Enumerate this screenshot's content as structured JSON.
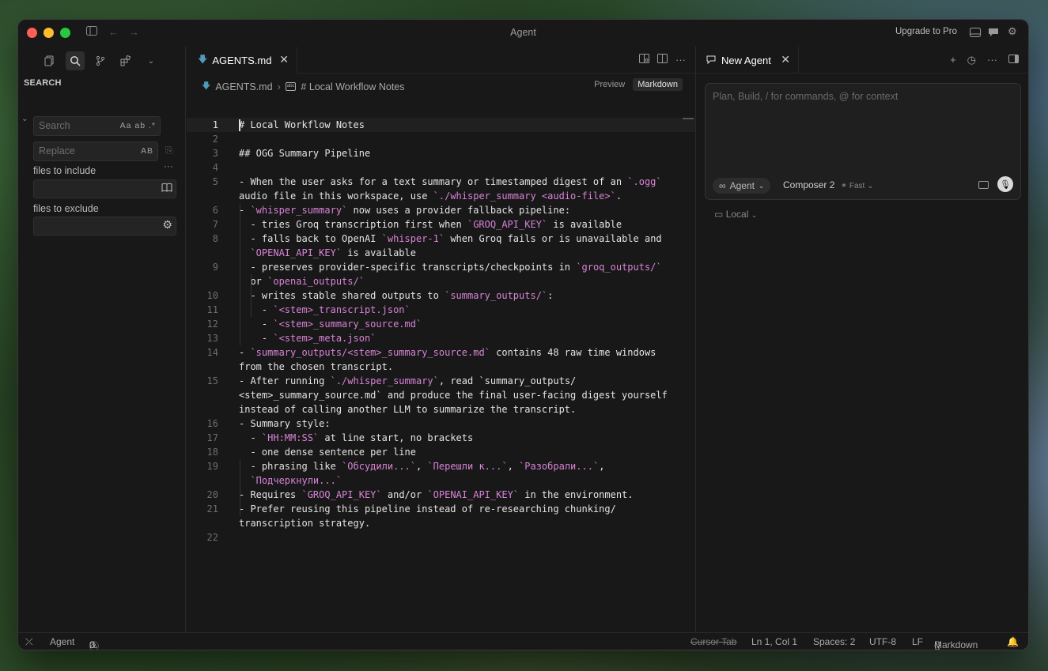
{
  "window": {
    "title": "Agent",
    "upgrade_label": "Upgrade to Pro"
  },
  "sidebar": {
    "title": "SEARCH",
    "search": {
      "placeholder": "Search",
      "options": "Aa ab .*"
    },
    "replace": {
      "placeholder": "Replace",
      "options": "AB"
    },
    "include_label": "files to include",
    "exclude_label": "files to exclude",
    "more": "···"
  },
  "editor": {
    "tab_label": "AGENTS.md",
    "breadcrumb": {
      "file": "AGENTS.md",
      "heading": "# Local Workflow Notes"
    },
    "view": {
      "preview": "Preview",
      "markdown": "Markdown"
    },
    "lines": [
      {
        "n": "1",
        "t": "# Local Workflow Notes"
      },
      {
        "n": "2",
        "t": ""
      },
      {
        "n": "3",
        "t": "## OGG Summary Pipeline"
      },
      {
        "n": "4",
        "t": ""
      },
      {
        "n": "5",
        "t": "- When the user asks for a text summary or timestamped digest of an `.ogg`\naudio file in this workspace, use `./whisper_summary <audio-file>`."
      },
      {
        "n": "6",
        "t": "- `whisper_summary` now uses a provider fallback pipeline:"
      },
      {
        "n": "7",
        "t": "  - tries Groq transcription first when `GROQ_API_KEY` is available"
      },
      {
        "n": "8",
        "t": "  - falls back to OpenAI `whisper-1` when Groq fails or is unavailable and\n  `OPENAI_API_KEY` is available"
      },
      {
        "n": "9",
        "t": "  - preserves provider-specific transcripts/checkpoints in `groq_outputs/`\n  or `openai_outputs/`"
      },
      {
        "n": "10",
        "t": "  - writes stable shared outputs to `summary_outputs/`:"
      },
      {
        "n": "11",
        "t": "    - `<stem>_transcript.json`"
      },
      {
        "n": "12",
        "t": "    - `<stem>_summary_source.md`"
      },
      {
        "n": "13",
        "t": "    - `<stem>_meta.json`"
      },
      {
        "n": "14",
        "t": "- `summary_outputs/<stem>_summary_source.md` contains 48 raw time windows\nfrom the chosen transcript."
      },
      {
        "n": "15",
        "t": "- After running `./whisper_summary`, read `summary_outputs/\n<stem>_summary_source.md` and produce the final user-facing digest yourself\ninstead of calling another LLM to summarize the transcript."
      },
      {
        "n": "16",
        "t": "- Summary style:"
      },
      {
        "n": "17",
        "t": "  - `HH:MM:SS` at line start, no brackets"
      },
      {
        "n": "18",
        "t": "  - one dense sentence per line"
      },
      {
        "n": "19",
        "t": "  - phrasing like `Обсудили...`, `Перешли к...`, `Разобрали...`,\n  `Подчеркнули...`"
      },
      {
        "n": "20",
        "t": "- Requires `GROQ_API_KEY` and/or `OPENAI_API_KEY` in the environment."
      },
      {
        "n": "21",
        "t": "- Prefer reusing this pipeline instead of re-researching chunking/\ntranscription strategy."
      },
      {
        "n": "22",
        "t": ""
      }
    ]
  },
  "agent": {
    "tab_label": "New Agent",
    "placeholder": "Plan, Build, / for commands, @ for context",
    "mode": "Agent",
    "model": "Composer 2",
    "speed": "Fast",
    "location": "Local"
  },
  "statusbar": {
    "agent": "Agent",
    "errors": "0",
    "warnings": "0",
    "cursor_tab": "Cursor Tab",
    "position": "Ln 1, Col 1",
    "spaces": "Spaces: 2",
    "encoding": "UTF-8",
    "eol": "LF",
    "language": "Markdown"
  },
  "colors": {
    "accent_code": "#d783d6",
    "md_icon": "#519aba"
  }
}
